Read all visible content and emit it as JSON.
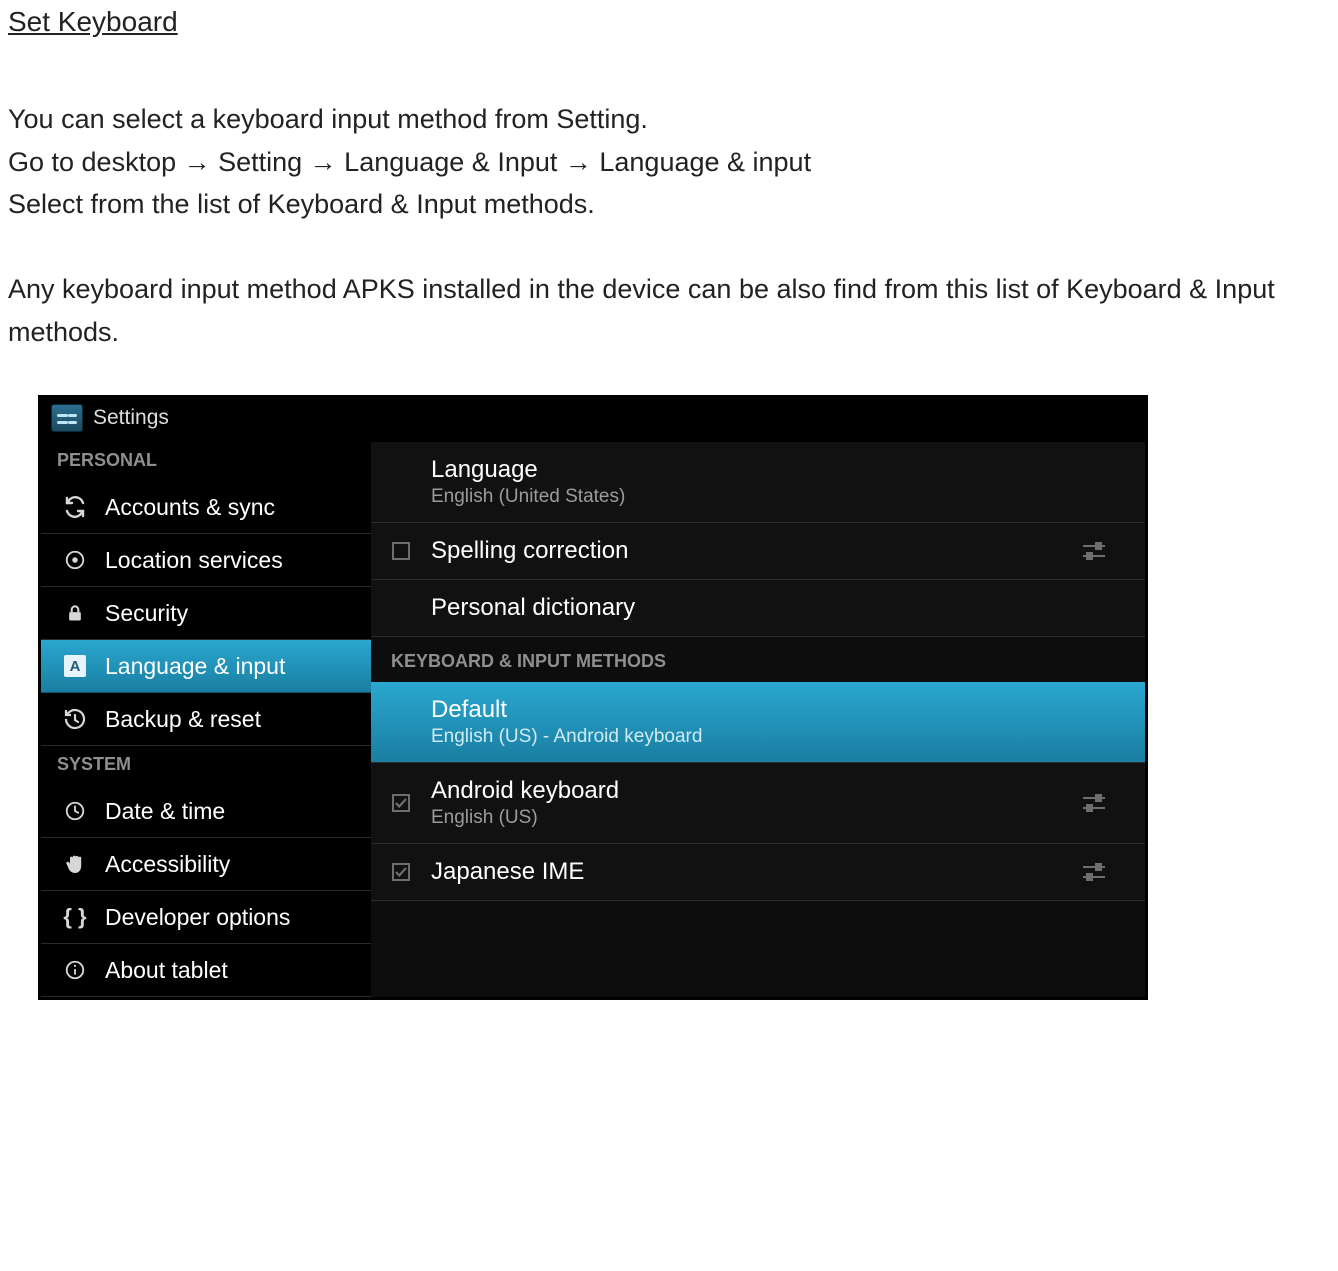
{
  "doc": {
    "title": "Set Keyboard",
    "p1_l1": "You can select a keyboard input method from Setting.",
    "p1_l2a": "Go to desktop ",
    "p1_l2b": " Setting ",
    "p1_l2c": " Language & Input ",
    "p1_l2d": " Language & input",
    "p1_l3": "Select from the list of Keyboard & Input methods.",
    "p2": "Any keyboard input method APKS installed in the device can be also find from this list of Keyboard & Input methods.",
    "arrow": "→"
  },
  "settings": {
    "header": "Settings",
    "sidebar_groups": {
      "personal": "PERSONAL",
      "system": "SYSTEM"
    },
    "sidebar": {
      "accounts": "Accounts & sync",
      "location": "Location services",
      "security": "Security",
      "language": "Language & input",
      "backup": "Backup & reset",
      "datetime": "Date & time",
      "accessibility": "Accessibility",
      "developer": "Developer options",
      "about": "About tablet"
    },
    "detail": {
      "language_title": "Language",
      "language_sub": "English (United States)",
      "spelling": "Spelling correction",
      "personal_dict": "Personal dictionary",
      "section_kb": "KEYBOARD & INPUT METHODS",
      "default_title": "Default",
      "default_sub": "English (US) - Android keyboard",
      "android_kb_title": "Android keyboard",
      "android_kb_sub": "English (US)",
      "jp_ime": "Japanese IME"
    }
  }
}
